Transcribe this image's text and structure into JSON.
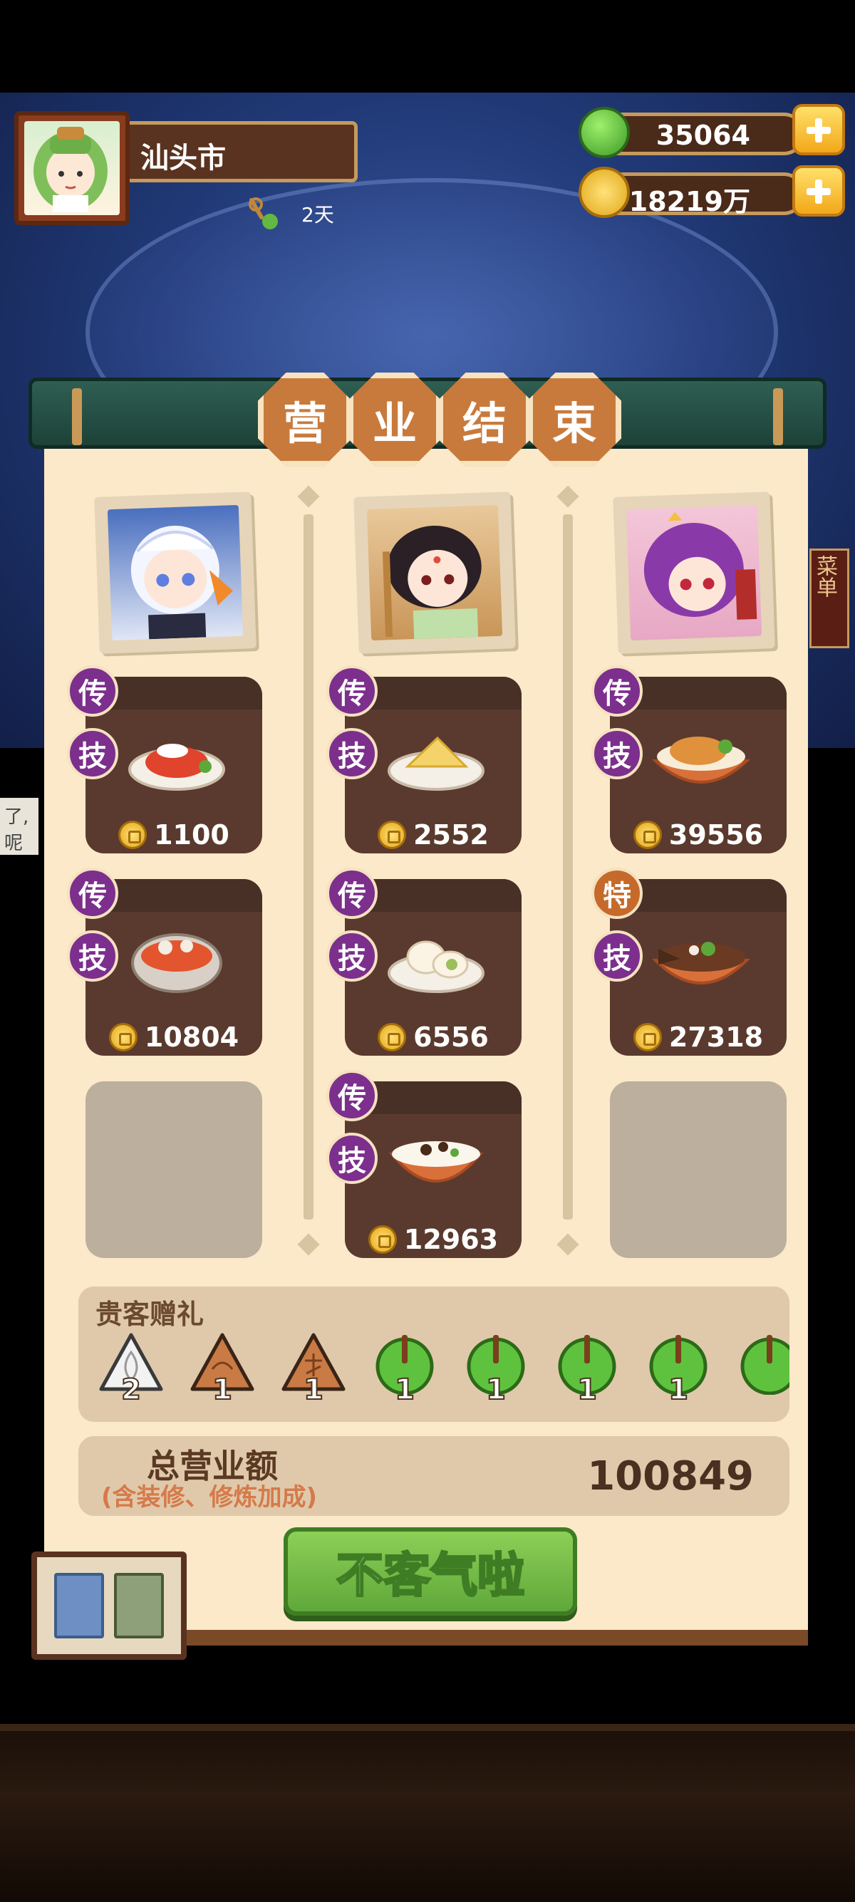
{
  "hud": {
    "city_name": "汕头市",
    "days": "2天",
    "jade": "35064",
    "coins": "18219万"
  },
  "title_chars": [
    "营",
    "业",
    "结",
    "束"
  ],
  "side_tab_text": [
    "了,",
    "呢"
  ],
  "right_side_tab": "菜单",
  "columns": [
    {
      "dishes": [
        {
          "badge_top": "传",
          "badge_bottom": "技",
          "earnings": "1100"
        },
        {
          "badge_top": "传",
          "badge_bottom": "技",
          "earnings": "10804"
        }
      ]
    },
    {
      "dishes": [
        {
          "badge_top": "传",
          "badge_bottom": "技",
          "earnings": "2552"
        },
        {
          "badge_top": "传",
          "badge_bottom": "技",
          "earnings": "6556"
        },
        {
          "badge_top": "传",
          "badge_bottom": "技",
          "earnings": "12963"
        }
      ]
    },
    {
      "dishes": [
        {
          "badge_top": "传",
          "badge_bottom": "技",
          "earnings": "39556"
        },
        {
          "badge_top": "特",
          "badge_bottom": "技",
          "earnings": "27318"
        }
      ]
    }
  ],
  "gifts": {
    "label": "贵客赠礼",
    "items": [
      {
        "icon": "silver-leaf-icon",
        "count": "2"
      },
      {
        "icon": "bronze-cloud-icon",
        "count": "1"
      },
      {
        "icon": "bronze-symbol-icon",
        "count": "1"
      },
      {
        "icon": "jade-gem-icon",
        "count": "1"
      },
      {
        "icon": "jade-gem-icon",
        "count": "1"
      },
      {
        "icon": "jade-gem-icon",
        "count": "1"
      },
      {
        "icon": "jade-gem-icon",
        "count": "1"
      },
      {
        "icon": "jade-gem-icon",
        "count": ""
      }
    ]
  },
  "total": {
    "label": "总营业额",
    "sub_label": "(含装修、修炼加成)",
    "value": "100849"
  },
  "confirm_button": "不客气啦",
  "colors": {
    "panel": "#fbe9c9",
    "dish_card": "#5a3a2e",
    "badge_purple": "#7c2f8c",
    "badge_orange": "#c56a2a",
    "button_green": "#6fb844"
  }
}
